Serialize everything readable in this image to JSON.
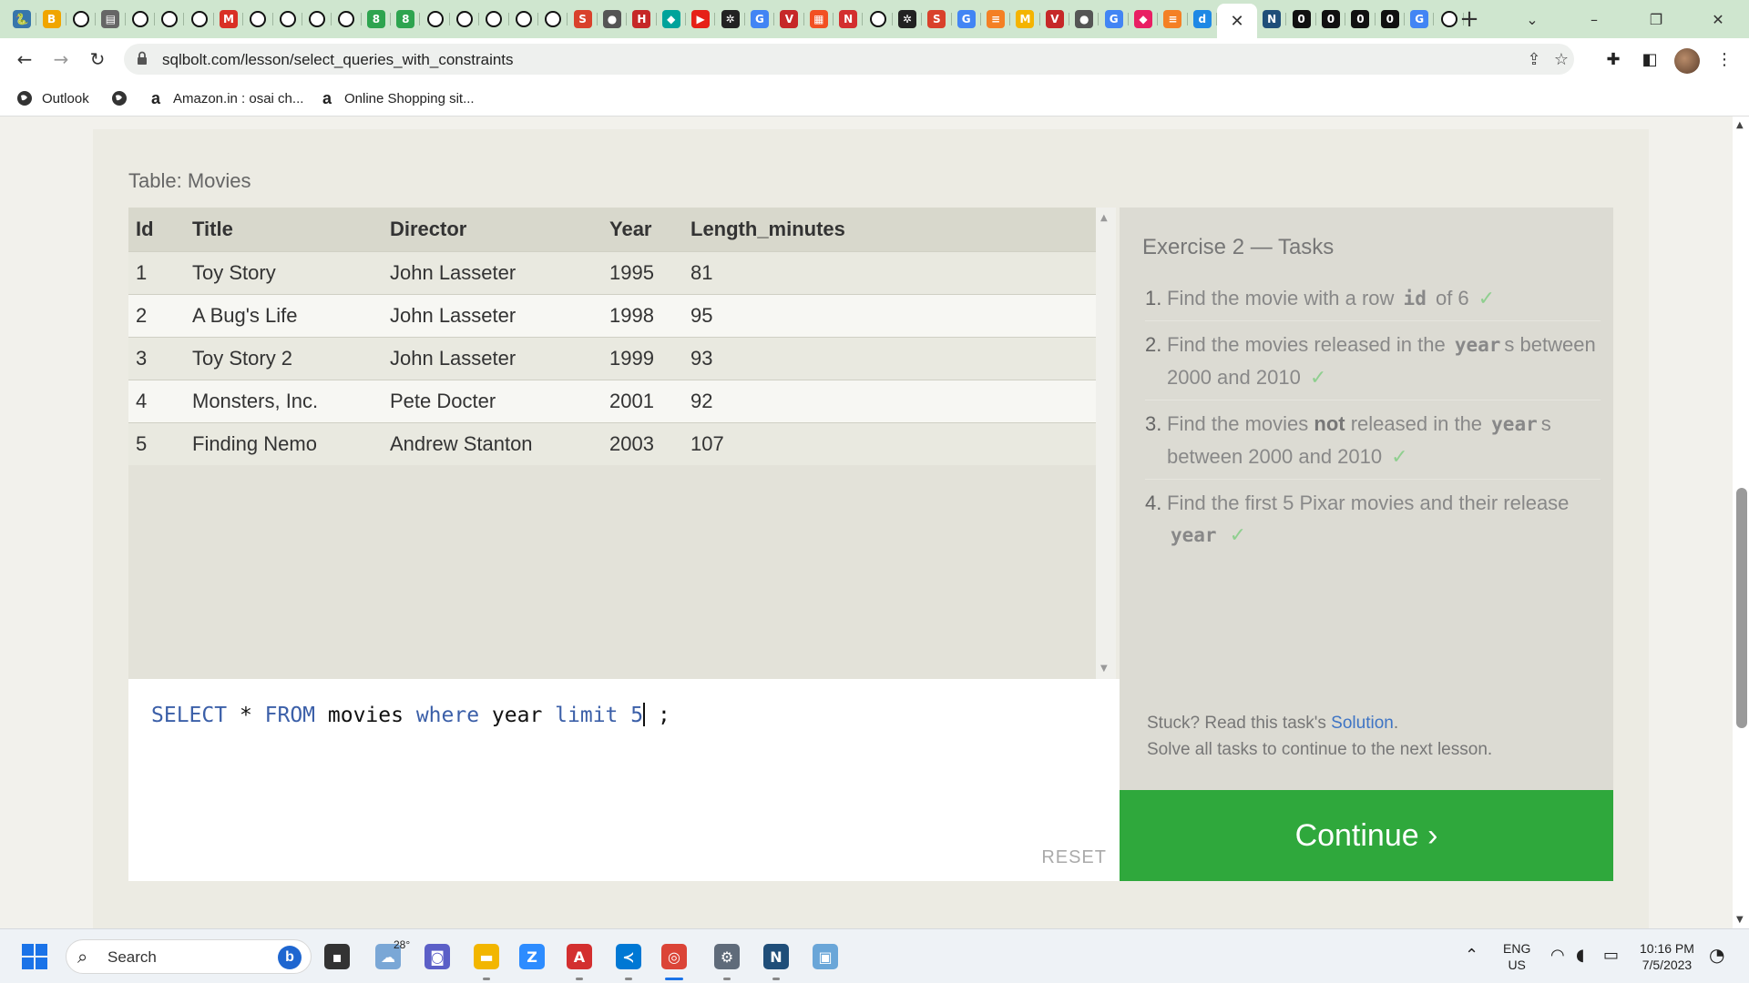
{
  "browser": {
    "tabs": [
      {
        "icon": "python-icon",
        "glyph": "🐍",
        "color": "#3776ab"
      },
      {
        "icon": "bjn-icon",
        "glyph": "B",
        "color": "#f0a500"
      },
      {
        "icon": "github-icon",
        "glyph": "◉",
        "color": "#111"
      },
      {
        "icon": "document-icon",
        "glyph": "▤",
        "color": "#666"
      },
      {
        "icon": "github-icon",
        "glyph": "◉",
        "color": "#111"
      },
      {
        "icon": "github-icon",
        "glyph": "◉",
        "color": "#111"
      },
      {
        "icon": "github-icon",
        "glyph": "◉",
        "color": "#111"
      },
      {
        "icon": "gmail-icon",
        "glyph": "M",
        "color": "#d93025"
      },
      {
        "icon": "github-icon",
        "glyph": "◉",
        "color": "#111"
      },
      {
        "icon": "github-icon",
        "glyph": "◉",
        "color": "#111"
      },
      {
        "icon": "github-icon",
        "glyph": "◉",
        "color": "#111"
      },
      {
        "icon": "github-icon",
        "glyph": "◉",
        "color": "#111"
      },
      {
        "icon": "green-app-icon",
        "glyph": "8",
        "color": "#2ea44f"
      },
      {
        "icon": "green-app-icon",
        "glyph": "8",
        "color": "#2ea44f"
      },
      {
        "icon": "github-icon",
        "glyph": "◉",
        "color": "#111"
      },
      {
        "icon": "github-icon",
        "glyph": "◉",
        "color": "#111"
      },
      {
        "icon": "github-icon",
        "glyph": "◉",
        "color": "#111"
      },
      {
        "icon": "github-icon",
        "glyph": "◉",
        "color": "#111"
      },
      {
        "icon": "github-icon",
        "glyph": "◉",
        "color": "#111"
      },
      {
        "icon": "s-app-icon",
        "glyph": "S",
        "color": "#d9412b"
      },
      {
        "icon": "globe-icon",
        "glyph": "●",
        "color": "#555"
      },
      {
        "icon": "hud-icon",
        "glyph": "H",
        "color": "#c62828"
      },
      {
        "icon": "diamond-icon",
        "glyph": "◆",
        "color": "#00a39b"
      },
      {
        "icon": "youtube-icon",
        "glyph": "▶",
        "color": "#e62117"
      },
      {
        "icon": "react-icon",
        "glyph": "✲",
        "color": "#222"
      },
      {
        "icon": "google-icon",
        "glyph": "G",
        "color": "#4285f4"
      },
      {
        "icon": "v-app-icon",
        "glyph": "V",
        "color": "#c62828"
      },
      {
        "icon": "microsoft-icon",
        "glyph": "▦",
        "color": "#f25022"
      },
      {
        "icon": "n-app-icon",
        "glyph": "N",
        "color": "#d32f2f"
      },
      {
        "icon": "github-icon",
        "glyph": "◉",
        "color": "#111"
      },
      {
        "icon": "react-icon",
        "glyph": "✲",
        "color": "#222"
      },
      {
        "icon": "s-app-icon",
        "glyph": "S",
        "color": "#d9412b"
      },
      {
        "icon": "google-icon",
        "glyph": "G",
        "color": "#4285f4"
      },
      {
        "icon": "stackoverflow-icon",
        "glyph": "≡",
        "color": "#f48024"
      },
      {
        "icon": "m-app-icon",
        "glyph": "M",
        "color": "#f4b400"
      },
      {
        "icon": "v-app-icon",
        "glyph": "V",
        "color": "#c62828"
      },
      {
        "icon": "globe-icon",
        "glyph": "●",
        "color": "#555"
      },
      {
        "icon": "google-icon",
        "glyph": "G",
        "color": "#4285f4"
      },
      {
        "icon": "shape-icon",
        "glyph": "◆",
        "color": "#e91e63"
      },
      {
        "icon": "stackoverflow-icon",
        "glyph": "≡",
        "color": "#f48024"
      },
      {
        "icon": "d-app-icon",
        "glyph": "d",
        "color": "#1e88e5"
      },
      {
        "icon": "close-icon",
        "glyph": "✕",
        "color": "#333",
        "active": true
      },
      {
        "icon": "vs-icon",
        "glyph": "N",
        "color": "#1f4e79"
      },
      {
        "icon": "dark-app-icon",
        "glyph": "0",
        "color": "#111"
      },
      {
        "icon": "dark-app-icon",
        "glyph": "0",
        "color": "#111"
      },
      {
        "icon": "dark-app-icon",
        "glyph": "0",
        "color": "#111"
      },
      {
        "icon": "dark-app-icon",
        "glyph": "0",
        "color": "#111"
      },
      {
        "icon": "google-icon",
        "glyph": "G",
        "color": "#4285f4"
      },
      {
        "icon": "github-icon",
        "glyph": "◉",
        "color": "#111"
      }
    ],
    "url": "sqlbolt.com/lesson/select_queries_with_constraints",
    "bookmarks": [
      {
        "label": "Outlook",
        "icon": "globe-icon"
      },
      {
        "label": "",
        "icon": "globe-icon"
      },
      {
        "label": "Amazon.in : osai ch...",
        "icon": "amazon-icon"
      },
      {
        "label": "Online Shopping sit...",
        "icon": "amazon-icon"
      }
    ]
  },
  "lesson": {
    "table_caption": "Table: Movies",
    "columns": [
      "Id",
      "Title",
      "Director",
      "Year",
      "Length_minutes"
    ],
    "rows": [
      [
        "1",
        "Toy Story",
        "John Lasseter",
        "1995",
        "81"
      ],
      [
        "2",
        "A Bug's Life",
        "John Lasseter",
        "1998",
        "95"
      ],
      [
        "3",
        "Toy Story 2",
        "John Lasseter",
        "1999",
        "93"
      ],
      [
        "4",
        "Monsters, Inc.",
        "Pete Docter",
        "2001",
        "92"
      ],
      [
        "5",
        "Finding Nemo",
        "Andrew Stanton",
        "2003",
        "107"
      ]
    ],
    "query_tokens": [
      {
        "t": "SELECT",
        "k": "kw"
      },
      {
        "t": " * ",
        "k": "id"
      },
      {
        "t": "FROM",
        "k": "kw"
      },
      {
        "t": " movies ",
        "k": "id"
      },
      {
        "t": "where",
        "k": "kw"
      },
      {
        "t": " year ",
        "k": "id"
      },
      {
        "t": "limit",
        "k": "kw"
      },
      {
        "t": " 5",
        "k": "kw"
      }
    ],
    "query_tail": " ;",
    "reset_label": "RESET"
  },
  "tasks": {
    "title": "Exercise 2 — Tasks",
    "items": [
      {
        "num": "1.",
        "parts": [
          {
            "t": "Find the movie with a row "
          },
          {
            "t": "id",
            "code": true
          },
          {
            "t": " of 6"
          }
        ]
      },
      {
        "num": "2.",
        "parts": [
          {
            "t": "Find the movies released in the "
          },
          {
            "t": "year",
            "code": true
          },
          {
            "t": "s between 2000 and 2010"
          }
        ]
      },
      {
        "num": "3.",
        "parts": [
          {
            "t": "Find the movies "
          },
          {
            "t": "not",
            "bold": true
          },
          {
            "t": " released in the "
          },
          {
            "t": "year",
            "code": true
          },
          {
            "t": "s between 2000 and 2010"
          }
        ]
      },
      {
        "num": "4.",
        "parts": [
          {
            "t": "Find the first 5 Pixar movies and their release "
          },
          {
            "t": "year",
            "code": true
          }
        ]
      }
    ],
    "check_mark": "✓",
    "stuck_prefix": "Stuck? Read this task's ",
    "solution_label": "Solution",
    "stuck_suffix": ".",
    "continue_hint": "Solve all tasks to continue to the next lesson.",
    "continue_label": "Continue ›"
  },
  "taskbar": {
    "search_label": "Search",
    "weather_temp": "28°",
    "apps": [
      {
        "name": "task-view-icon",
        "glyph": "▪",
        "color": "#333"
      },
      {
        "name": "weather-icon",
        "glyph": "☁",
        "color": "#7aa7d6"
      },
      {
        "name": "chat-icon",
        "glyph": "◙",
        "color": "#5b5fc7"
      },
      {
        "name": "file-explorer-icon",
        "glyph": "▬",
        "color": "#f2b600"
      },
      {
        "name": "zoom-icon",
        "glyph": "Z",
        "color": "#2d8cff"
      },
      {
        "name": "acrobat-icon",
        "glyph": "A",
        "color": "#d32f2f"
      },
      {
        "name": "vscode-icon",
        "glyph": "≺",
        "color": "#0078d4"
      },
      {
        "name": "chrome-icon",
        "glyph": "◎",
        "color": "#db4437"
      },
      {
        "name": "settings-icon",
        "glyph": "⚙",
        "color": "#5f6b7a"
      },
      {
        "name": "visual-studio-icon",
        "glyph": "N",
        "color": "#1f4e79"
      },
      {
        "name": "paint-icon",
        "glyph": "▣",
        "color": "#6aa6d8"
      }
    ],
    "lang_top": "ENG",
    "lang_bottom": "US",
    "time": "10:16 PM",
    "date": "7/5/2023"
  }
}
